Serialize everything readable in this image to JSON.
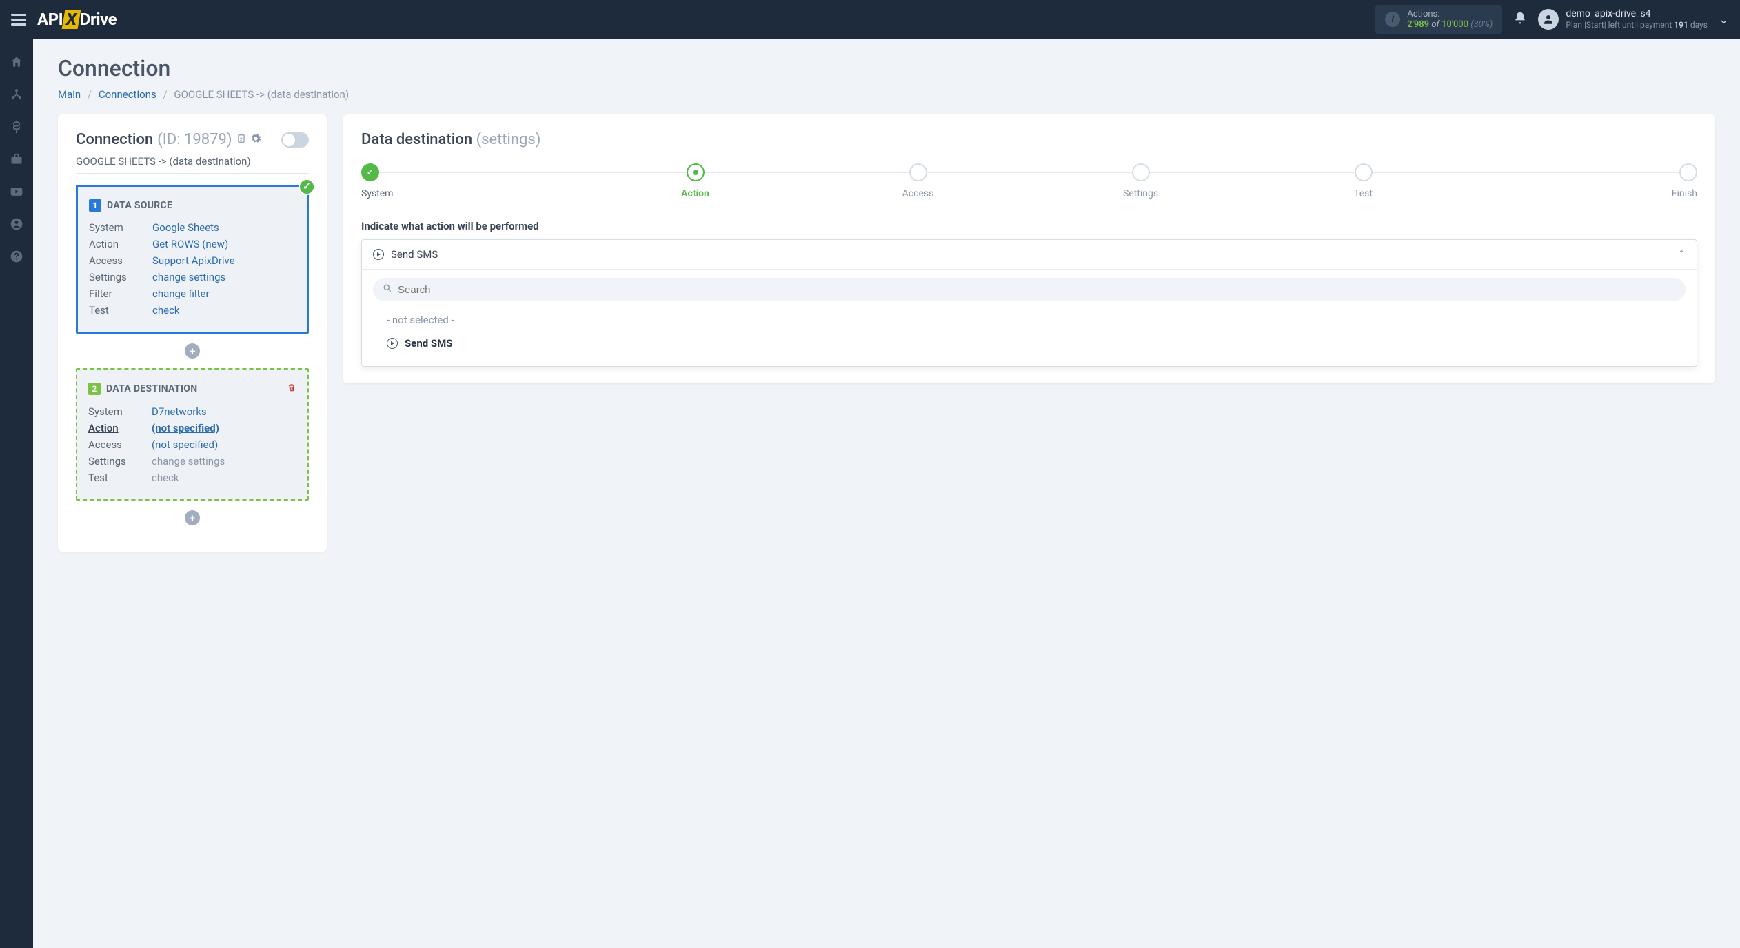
{
  "header": {
    "logo_pre": "API",
    "logo_x": "X",
    "logo_post": "Drive",
    "actions_label": "Actions:",
    "actions_used": "2'989",
    "actions_of": "of",
    "actions_total": "10'000",
    "actions_pct": "(30%)",
    "user_name": "demo_apix-drive_s4",
    "user_plan_pre": "Plan |Start| left until payment ",
    "user_plan_days": "191",
    "user_plan_post": " days"
  },
  "page": {
    "title": "Connection",
    "breadcrumb": {
      "main": "Main",
      "connections": "Connections",
      "current": "GOOGLE SHEETS -> (data destination)"
    }
  },
  "left": {
    "title": "Connection",
    "id_label": "(ID: 19879)",
    "subtitle": "GOOGLE SHEETS -> (data destination)",
    "source": {
      "num": "1",
      "title": "DATA SOURCE",
      "rows": {
        "system_k": "System",
        "system_v": "Google Sheets",
        "action_k": "Action",
        "action_v": "Get ROWS (new)",
        "access_k": "Access",
        "access_v": "Support ApixDrive",
        "settings_k": "Settings",
        "settings_v": "change settings",
        "filter_k": "Filter",
        "filter_v": "change filter",
        "test_k": "Test",
        "test_v": "check"
      }
    },
    "dest": {
      "num": "2",
      "title": "DATA DESTINATION",
      "rows": {
        "system_k": "System",
        "system_v": "D7networks",
        "action_k": "Action",
        "action_v": "(not specified)",
        "access_k": "Access",
        "access_v": "(not specified)",
        "settings_k": "Settings",
        "settings_v": "change settings",
        "test_k": "Test",
        "test_v": "check"
      }
    }
  },
  "right": {
    "title_main": "Data destination",
    "title_sub": "(settings)",
    "steps": {
      "system": "System",
      "action": "Action",
      "access": "Access",
      "settings": "Settings",
      "test": "Test",
      "finish": "Finish"
    },
    "section_label": "Indicate what action will be performed",
    "selected": "Send SMS",
    "search_placeholder": "Search",
    "opt_none": "- not selected -",
    "opt_send": "Send SMS"
  }
}
